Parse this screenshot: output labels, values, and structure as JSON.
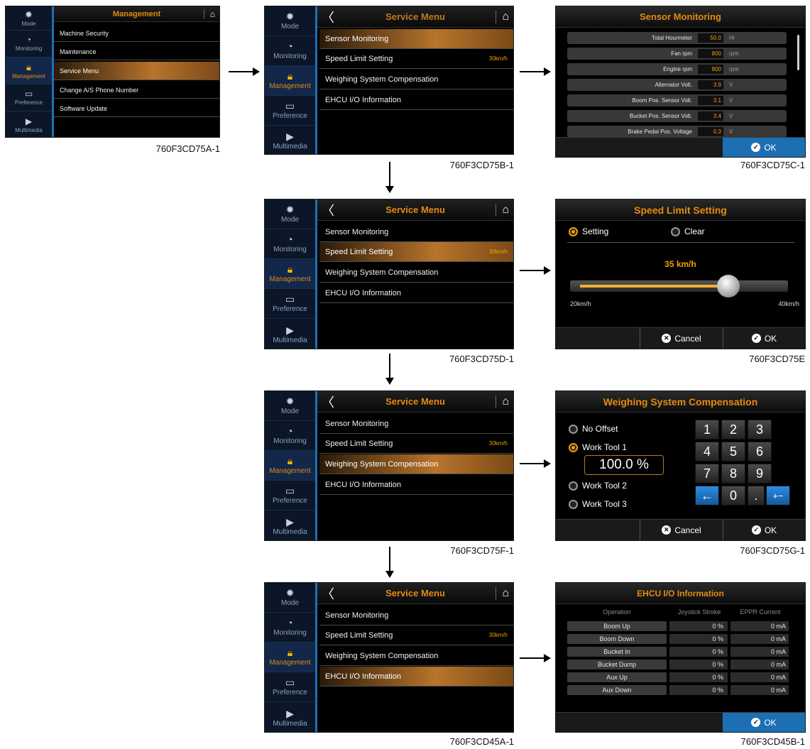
{
  "sidebar": {
    "items": [
      {
        "label": "Mode",
        "icon": "gear-icon"
      },
      {
        "label": "Monitoring",
        "icon": "gauge-icon"
      },
      {
        "label": "Management",
        "icon": "lock-icon"
      },
      {
        "label": "Preference",
        "icon": "monitor-icon"
      },
      {
        "label": "Multimedia",
        "icon": "play-icon"
      }
    ],
    "active": "Management"
  },
  "screen_a": {
    "title": "Management",
    "items": [
      "Machine Security",
      "Maintenance",
      "Service Menu",
      "Change A/S Phone Number",
      "Software Update"
    ],
    "selected": "Service Menu",
    "caption": "760F3CD75A-1"
  },
  "service_menu": {
    "title": "Service Menu",
    "items": [
      "Sensor Monitoring",
      "Speed Limit Setting",
      "Weighing System Compensation",
      "EHCU I/O Information"
    ],
    "speed_value": "30km/h",
    "captions": {
      "b": "760F3CD75B-1",
      "d": "760F3CD75D-1",
      "f": "760F3CD75F-1",
      "h": "760F3CD45A-1"
    },
    "selected": {
      "b": "Sensor Monitoring",
      "d": "Speed Limit Setting",
      "f": "Weighing System Compensation",
      "h": "EHCU I/O Information"
    }
  },
  "sensor_monitoring": {
    "title": "Sensor Monitoring",
    "rows": [
      {
        "label": "Total Hourmeter",
        "value": "50.0",
        "unit": "Hr"
      },
      {
        "label": "Fan rpm",
        "value": "800",
        "unit": "rpm"
      },
      {
        "label": "Engine rpm",
        "value": "800",
        "unit": "rpm"
      },
      {
        "label": "Alternator Volt.",
        "value": "3.9",
        "unit": "V"
      },
      {
        "label": "Boom Pos. Sensor Volt.",
        "value": "3.1",
        "unit": "V"
      },
      {
        "label": "Bucket Pos. Sensor Volt.",
        "value": "3.4",
        "unit": "V"
      },
      {
        "label": "Brake Pedal Pos. Voltage",
        "value": "0.3",
        "unit": "V"
      }
    ],
    "ok_label": "OK",
    "caption": "760F3CD75C-1"
  },
  "speed_limit": {
    "title": "Speed Limit Setting",
    "option_setting": "Setting",
    "option_clear": "Clear",
    "selected_option": "Setting",
    "current_value": "35 km/h",
    "min_label": "20km/h",
    "max_label": "40km/h",
    "level": 0.75,
    "cancel_label": "Cancel",
    "ok_label": "OK",
    "caption": "760F3CD75E"
  },
  "weighing": {
    "title": "Weighing System Compensation",
    "options": [
      "No Offset",
      "Work Tool 1",
      "Work Tool 2",
      "Work Tool 3"
    ],
    "selected_option": "Work Tool 1",
    "value": "100.0 %",
    "keys": [
      "1",
      "2",
      "3",
      "4",
      "5",
      "6",
      "7",
      "8",
      "9",
      "←",
      "0",
      ".",
      "+-"
    ],
    "cancel_label": "Cancel",
    "ok_label": "OK",
    "caption": "760F3CD75G-1"
  },
  "ehcu": {
    "title": "EHCU I/O Information",
    "headers": [
      "Operation",
      "Joystick Stroke",
      "EPPR Current"
    ],
    "rows": [
      {
        "op": "Boom Up",
        "stroke": "0 %",
        "current": "0 mA"
      },
      {
        "op": "Boom Down",
        "stroke": "0 %",
        "current": "0 mA"
      },
      {
        "op": "Bucket In",
        "stroke": "0 %",
        "current": "0 mA"
      },
      {
        "op": "Bucket Dump",
        "stroke": "0 %",
        "current": "0 mA"
      },
      {
        "op": "Aux Up",
        "stroke": "0 %",
        "current": "0 mA"
      },
      {
        "op": "Aux Down",
        "stroke": "0 %",
        "current": "0 mA"
      }
    ],
    "ok_label": "OK",
    "caption": "760F3CD45B-1"
  },
  "colors": {
    "accent": "#e48a10",
    "value": "#f0a000",
    "blue": "#1d6fb3"
  }
}
